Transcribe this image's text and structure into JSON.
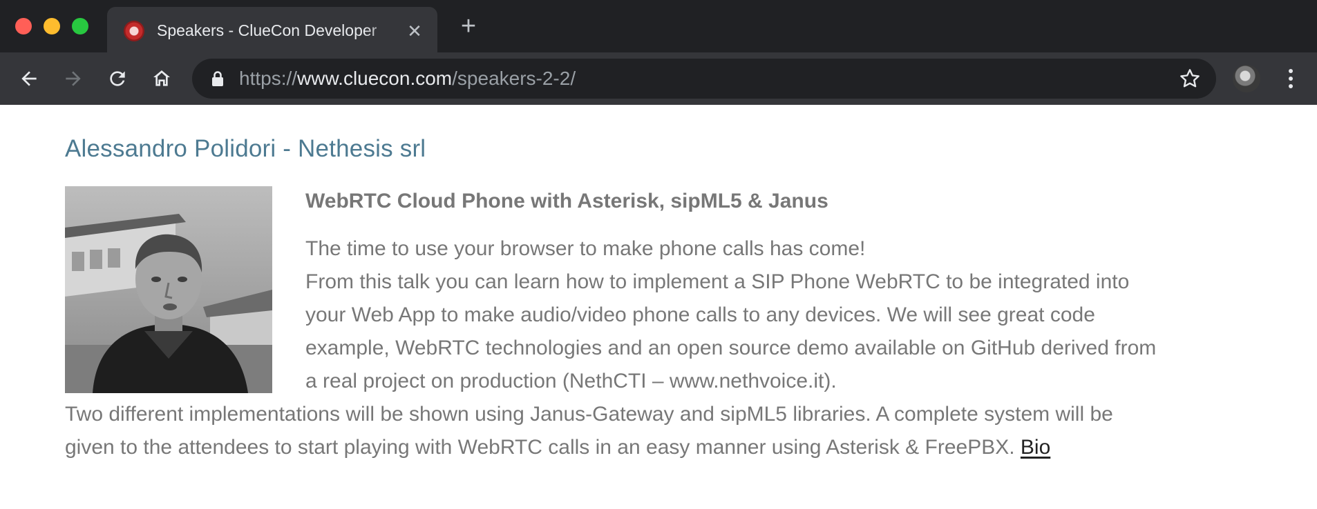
{
  "browser": {
    "tab": {
      "title": "Speakers - ClueCon Developer",
      "close_symbol": "✕",
      "favicon": "cluecon-phone-icon"
    },
    "new_tab_symbol": "+",
    "url": {
      "scheme": "https://",
      "host": "www.cluecon.com",
      "path": "/speakers-2-2/"
    },
    "icons": [
      "back-arrow-icon",
      "forward-arrow-icon",
      "reload-icon",
      "home-icon",
      "lock-icon",
      "star-icon",
      "avatar",
      "more-vert-icon"
    ],
    "colors": {
      "tabbar": "#202124",
      "toolbar": "#35363a",
      "omnibox": "#202124"
    }
  },
  "speaker": {
    "name": "Alessandro Polidori - Nethesis srl",
    "talk_title": "WebRTC Cloud Phone with Asterisk, sipML5 & Janus",
    "paragraph_lines_indented": [
      "The time to use your browser to make phone calls has come!",
      "From this talk you can learn how to implement a SIP Phone WebRTC to be integrated into",
      "your Web App to make audio/video phone calls to any devices. We will see great code",
      "example, WebRTC technologies and an open source demo available on GitHub derived from",
      "a real project on production (NethCTI – www.nethvoice.it)."
    ],
    "paragraph_lines_full": [
      "Two different implementations will be shown using Janus-Gateway and sipML5 libraries. A complete system will be",
      "given to the attendees to start playing with WebRTC calls in an easy manner using Asterisk & FreePBX. "
    ],
    "bio_link": "Bio",
    "colors": {
      "name": "#4d7a91",
      "text": "#777777",
      "link": "#222222"
    }
  }
}
